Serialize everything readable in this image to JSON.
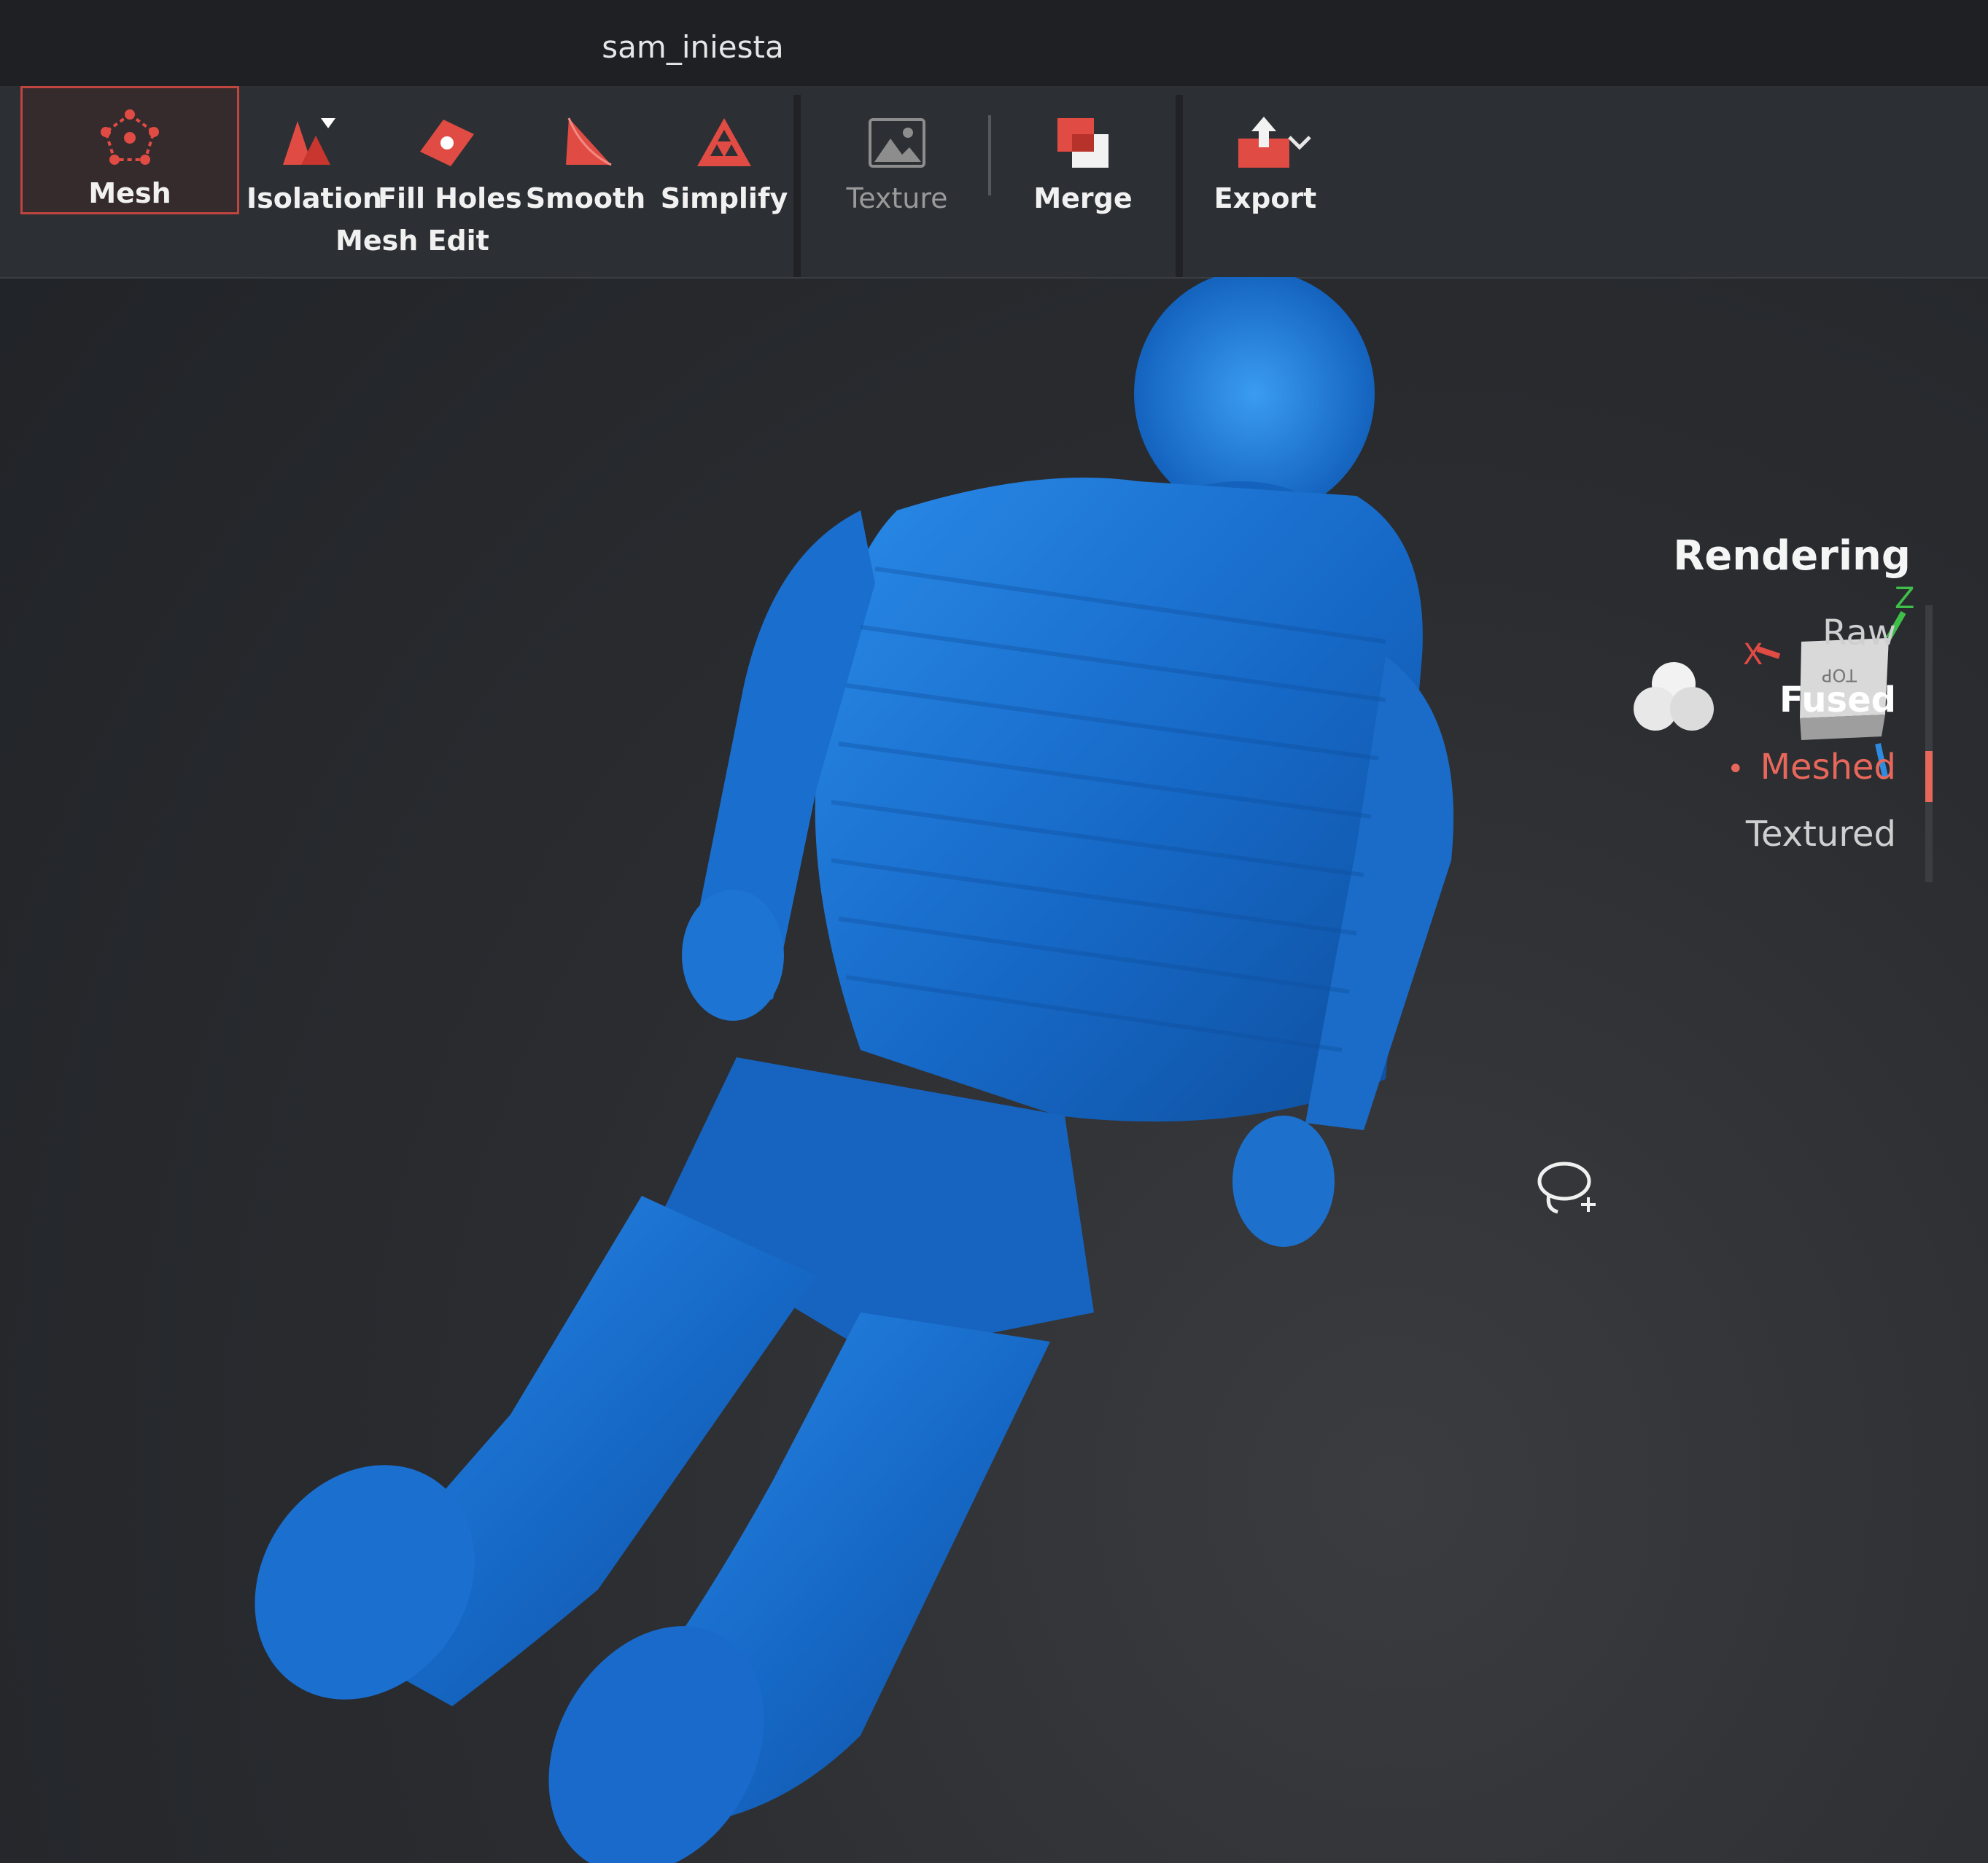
{
  "window": {
    "title": "sam_iniesta"
  },
  "toolbar": {
    "mesh": "Mesh",
    "isolation": "Isolation",
    "fill_holes": "Fill Holes",
    "smooth": "Smooth",
    "simplify": "Simplify",
    "mesh_edit_group": "Mesh Edit",
    "texture": "Texture",
    "merge": "Merge",
    "export": "Export"
  },
  "view_cube": {
    "x_axis": "X",
    "z_axis": "Z",
    "top_face": "TOP"
  },
  "rendering": {
    "title": "Rendering",
    "modes": [
      "Raw",
      "Fused",
      "Meshed",
      "Textured"
    ],
    "selected": "Meshed"
  },
  "colors": {
    "accent": "#e8675b",
    "mesh_blue": "#1a73d4",
    "background": "#2a2c30"
  },
  "icons": [
    "mesh-icon",
    "isolation-icon",
    "fill-holes-icon",
    "smooth-icon",
    "simplify-icon",
    "texture-icon",
    "merge-icon",
    "export-icon",
    "chevron-down-icon",
    "lighting-icon",
    "lasso-select-icon"
  ]
}
